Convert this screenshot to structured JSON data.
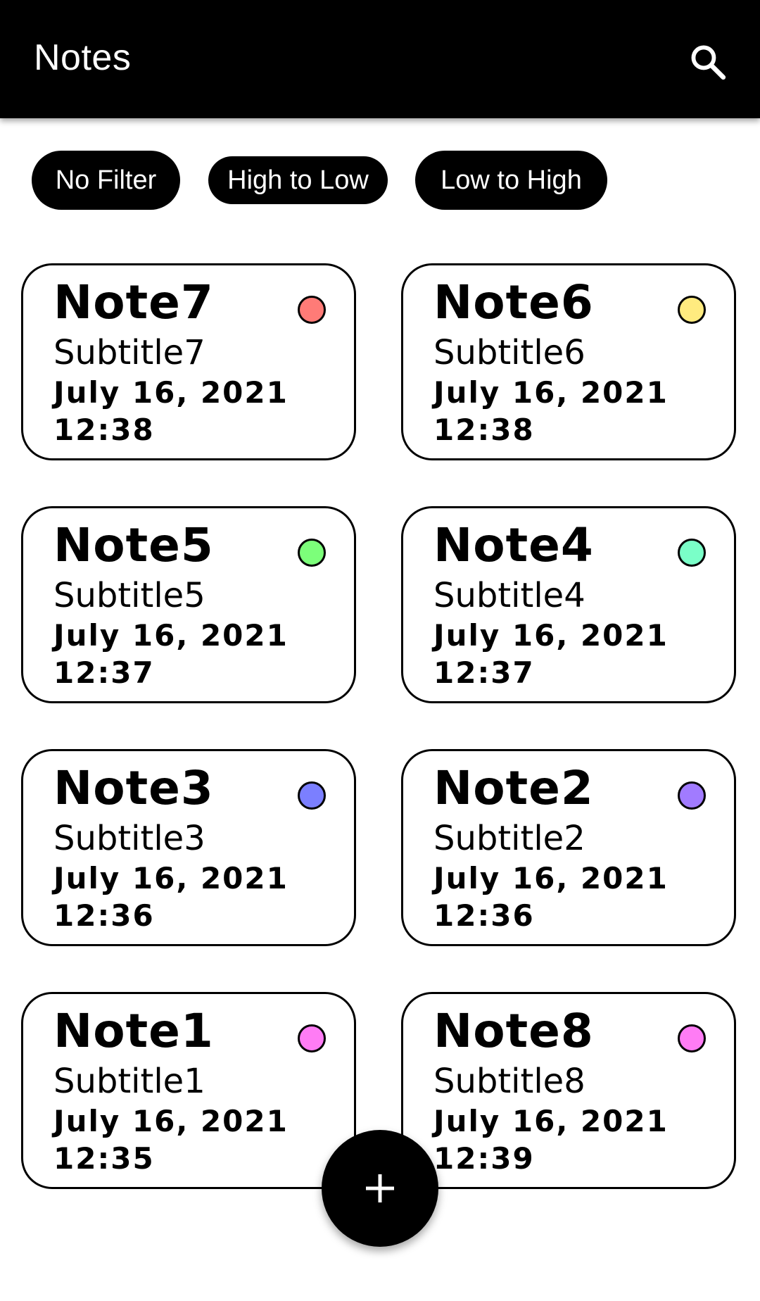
{
  "appbar": {
    "title": "Notes",
    "search_icon": "search-icon"
  },
  "filters": [
    {
      "label": "No Filter"
    },
    {
      "label": "High to Low"
    },
    {
      "label": "Low to High"
    }
  ],
  "notes": [
    {
      "title": "Note7",
      "subtitle": "Subtitle7",
      "date": "July 16, 2021",
      "time": "12:38",
      "color": "#ff7b77"
    },
    {
      "title": "Note6",
      "subtitle": "Subtitle6",
      "date": "July 16, 2021",
      "time": "12:38",
      "color": "#ffeb7f"
    },
    {
      "title": "Note5",
      "subtitle": "Subtitle5",
      "date": "July 16, 2021",
      "time": "12:37",
      "color": "#7cff7a"
    },
    {
      "title": "Note4",
      "subtitle": "Subtitle4",
      "date": "July 16, 2021",
      "time": "12:37",
      "color": "#7affc8"
    },
    {
      "title": "Note3",
      "subtitle": "Subtitle3",
      "date": "July 16, 2021",
      "time": "12:36",
      "color": "#7b7fff"
    },
    {
      "title": "Note2",
      "subtitle": "Subtitle2",
      "date": "July 16, 2021",
      "time": "12:36",
      "color": "#a17bff"
    },
    {
      "title": "Note1",
      "subtitle": "Subtitle1",
      "date": "July 16, 2021",
      "time": "12:35",
      "color": "#ff7cf5"
    },
    {
      "title": "Note8",
      "subtitle": "Subtitle8",
      "date": "July 16, 2021",
      "time": "12:39",
      "color": "#ff7cf5"
    }
  ],
  "fab": {
    "icon": "plus-icon"
  }
}
